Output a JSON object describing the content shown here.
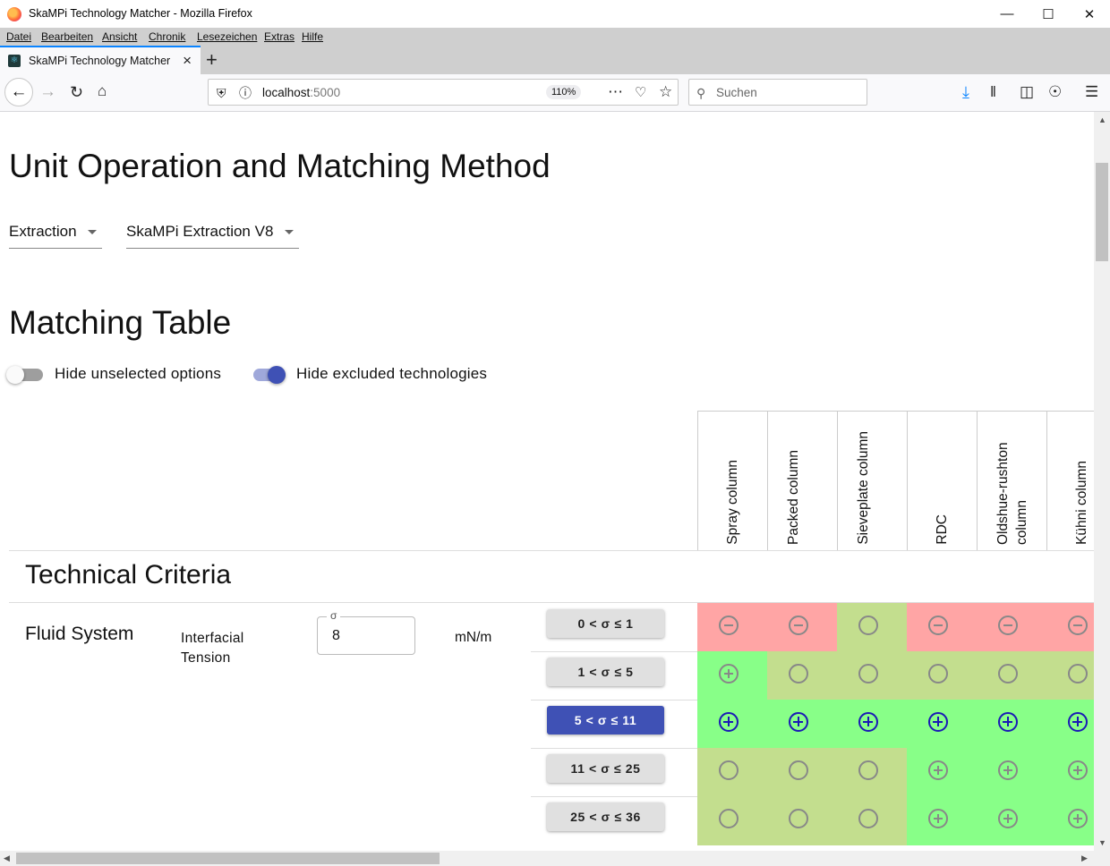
{
  "window": {
    "title": "SkaMPi Technology Matcher - Mozilla Firefox"
  },
  "menu": [
    "Datei",
    "Bearbeiten",
    "Ansicht",
    "Chronik",
    "Lesezeichen",
    "Extras",
    "Hilfe"
  ],
  "tab": {
    "label": "SkaMPi Technology Matcher"
  },
  "navbar": {
    "url_host": "localhost",
    "url_port": ":5000",
    "zoom": "110%",
    "search_placeholder": "Suchen"
  },
  "page": {
    "heading_unit": "Unit Operation and Matching Method",
    "unit_operation": "Extraction",
    "matching_method": "SkaMPi Extraction V8",
    "heading_table": "Matching Table",
    "toggle_hide_unselected": {
      "label": "Hide unselected options",
      "on": false
    },
    "toggle_hide_excluded": {
      "label": "Hide excluded technologies",
      "on": true
    },
    "section_title": "Technical Criteria",
    "group_title": "Fluid System",
    "property_label": "Interfacial Tension",
    "input_legend": "σ",
    "input_value": "8",
    "unit": "mN/m"
  },
  "technologies": [
    "Spray column",
    "Packed column",
    "Sieveplate column",
    "RDC",
    "Oldshue-rushton column",
    "Kühni column"
  ],
  "colors": {
    "excluded": "#ffa5a5",
    "neutral": "#c3de8e",
    "favored": "#88ff88",
    "selected_button": "#3f51b5"
  },
  "ranges": [
    {
      "label": "0 < σ ≤ 1",
      "selected": false,
      "cells": [
        [
          "excluded",
          "minus"
        ],
        [
          "excluded",
          "minus"
        ],
        [
          "neutral",
          "neutral"
        ],
        [
          "excluded",
          "minus"
        ],
        [
          "excluded",
          "minus"
        ],
        [
          "excluded",
          "minus"
        ]
      ]
    },
    {
      "label": "1 < σ ≤ 5",
      "selected": false,
      "cells": [
        [
          "favored",
          "plus"
        ],
        [
          "neutral",
          "neutral"
        ],
        [
          "neutral",
          "neutral"
        ],
        [
          "neutral",
          "neutral"
        ],
        [
          "neutral",
          "neutral"
        ],
        [
          "neutral",
          "neutral"
        ]
      ]
    },
    {
      "label": "5 < σ ≤ 11",
      "selected": true,
      "cells": [
        [
          "favored",
          "plusb"
        ],
        [
          "favored",
          "plusb"
        ],
        [
          "favored",
          "plusb"
        ],
        [
          "favored",
          "plusb"
        ],
        [
          "favored",
          "plusb"
        ],
        [
          "favored",
          "plusb"
        ]
      ]
    },
    {
      "label": "11 < σ ≤ 25",
      "selected": false,
      "cells": [
        [
          "neutral",
          "neutral"
        ],
        [
          "neutral",
          "neutral"
        ],
        [
          "neutral",
          "neutral"
        ],
        [
          "favored",
          "plus"
        ],
        [
          "favored",
          "plus"
        ],
        [
          "favored",
          "plus"
        ]
      ]
    },
    {
      "label": "25 < σ ≤ 36",
      "selected": false,
      "cells": [
        [
          "neutral",
          "neutral"
        ],
        [
          "neutral",
          "neutral"
        ],
        [
          "neutral",
          "neutral"
        ],
        [
          "favored",
          "plus"
        ],
        [
          "favored",
          "plus"
        ],
        [
          "favored",
          "plus"
        ]
      ]
    }
  ]
}
